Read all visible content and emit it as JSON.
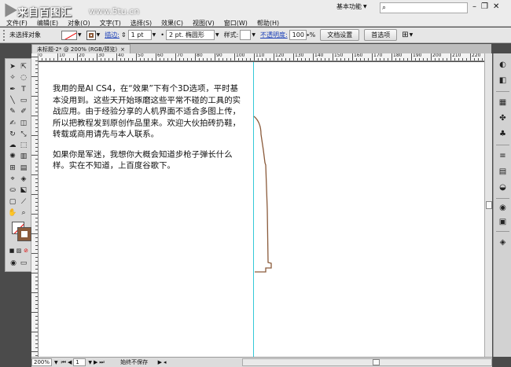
{
  "watermark": {
    "title": "来自百图汇",
    "url": "www.5tu.cn"
  },
  "menu": {
    "items": [
      "文件(F)",
      "编辑(E)",
      "对象(O)",
      "文字(T)",
      "选择(S)",
      "效果(C)",
      "视图(V)",
      "窗口(W)",
      "帮助(H)"
    ]
  },
  "workspace": {
    "label": "基本功能"
  },
  "window_controls": {
    "minimize": "–",
    "restore": "❐",
    "close": "✕"
  },
  "control_bar": {
    "selection_status": "未选择对象",
    "stroke_label": "描边:",
    "stroke_weight": "1 pt",
    "brush_label": "2 pt. 椭圆形",
    "style_label": "样式:",
    "opacity_label": "不透明度:",
    "opacity_value": "100",
    "opacity_unit": "%",
    "doc_settings_button": "文档设置",
    "preferences_button": "首选项"
  },
  "document_tab": {
    "title": "未标题-2* @ 200% (RGB/预览)",
    "close": "×"
  },
  "ruler": {
    "top_labels": [
      "0",
      "10",
      "20",
      "30",
      "40",
      "50",
      "60",
      "70",
      "80",
      "90",
      "100",
      "110",
      "120",
      "130",
      "140",
      "150",
      "160",
      "170",
      "180",
      "190",
      "200",
      "210",
      "220"
    ]
  },
  "article": {
    "paragraph1": "我用的是AI CS4，在“效果”下有个3D选项，平时基本没用到。这些天开始琢磨这些平常不碰的工具的实战应用。由于经验分享的人机界面不适合多图上传，所以把教程发到原创作品里来。欢迎大伙拍砖扔鞋，转载或商用请先与本人联系。",
    "paragraph2": "如果你是军迷，我想你大概会知道步枪子弹长什么样。实在不知道，上百度谷歌下。"
  },
  "colors": {
    "guide": "#34c8d8",
    "profile_stroke": "#8a5a3a",
    "stroke_swatch": "#8a5a3a"
  },
  "status_bar": {
    "zoom": "200%",
    "page": "1",
    "status_text": "始终不保存"
  }
}
